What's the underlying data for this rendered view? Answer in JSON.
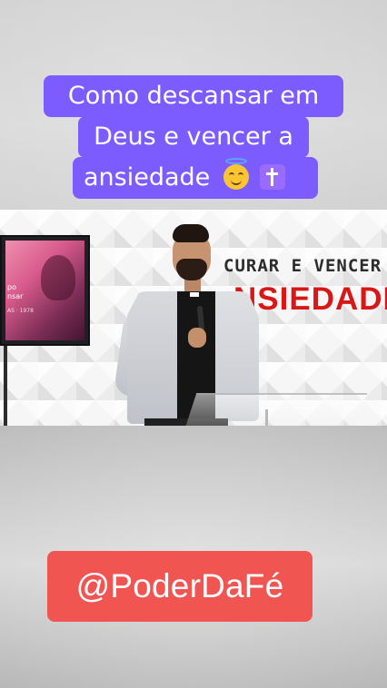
{
  "caption": {
    "lines": [
      "Como descansar em",
      "Deus e vencer a",
      "ansiedade"
    ],
    "emoji_icons": [
      "smiling-face-with-halo-icon",
      "latin-cross-icon"
    ],
    "background_color": "#7c5cff",
    "text_color": "#ffffff"
  },
  "video": {
    "screen_text": [
      "po",
      "nsar",
      "AS · 1978"
    ],
    "banner_line_1": "CURAR E VENCER",
    "banner_line_2": "NSIEDADE",
    "banner_text_color": "#2c2c2c",
    "banner_accent_color": "#d81717"
  },
  "footer": {
    "handle": "@PoderDaFé",
    "background_color": "#f05552",
    "text_color": "#ffffff"
  }
}
